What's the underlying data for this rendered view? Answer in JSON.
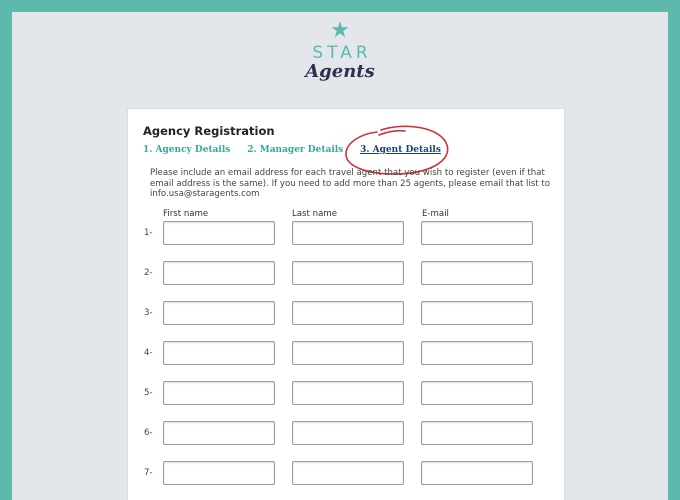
{
  "logo": {
    "star_icon": "star-icon",
    "word_star": "STAR",
    "word_agents": "Agents"
  },
  "form": {
    "title": "Agency Registration",
    "steps": [
      {
        "label": "1. Agency Details",
        "active": false
      },
      {
        "label": "2. Manager Details",
        "active": false
      },
      {
        "label": "3. Agent Details",
        "active": true
      }
    ],
    "note": "Please include an email address for each travel agent that you wish to register (even if that email address is the same). If you need to add more than 25 agents, please email that list to info.usa@staragents.com",
    "columns": {
      "first_name": "First name",
      "last_name": "Last name",
      "email": "E-mail"
    },
    "rows": [
      {
        "label": "1-",
        "first_name": "",
        "last_name": "",
        "email": ""
      },
      {
        "label": "2-",
        "first_name": "",
        "last_name": "",
        "email": ""
      },
      {
        "label": "3-",
        "first_name": "",
        "last_name": "",
        "email": ""
      },
      {
        "label": "4-",
        "first_name": "",
        "last_name": "",
        "email": ""
      },
      {
        "label": "5-",
        "first_name": "",
        "last_name": "",
        "email": ""
      },
      {
        "label": "6-",
        "first_name": "",
        "last_name": "",
        "email": ""
      },
      {
        "label": "7-",
        "first_name": "",
        "last_name": "",
        "email": ""
      }
    ]
  },
  "colors": {
    "frame": "#5fb8ac",
    "background": "#e3e6ea",
    "step_link": "#3aa79b",
    "active_step": "#1e3f7a",
    "annotation_circle": "#d0313a"
  }
}
